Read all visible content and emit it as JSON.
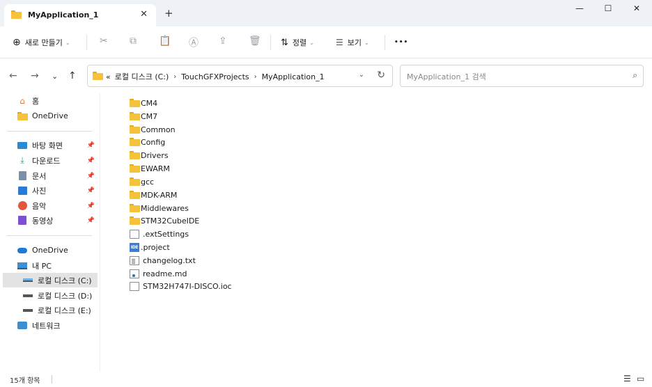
{
  "tab": {
    "title": "MyApplication_1",
    "close": "✕",
    "new_tab": "+"
  },
  "window": {
    "minimize": "—",
    "maximize": "☐",
    "close": "✕"
  },
  "toolbar": {
    "new_label": "새로 만들기",
    "new_plus": "⊕",
    "chevron": "⌄",
    "sort_label": "정렬",
    "sort_icon": "⇅",
    "view_label": "보기",
    "view_icon": "☰",
    "more": "•••",
    "icons": {
      "cut": "✂",
      "copy": "⧉",
      "paste": "📋",
      "rename": "Ⓐ",
      "share": "⇪",
      "delete": "🗑"
    }
  },
  "nav": {
    "back": "←",
    "forward": "→",
    "recent": "⌄",
    "up": "↑",
    "overflow": "«",
    "crumbs": [
      "로컬 디스크 (C:)",
      "TouchGFXProjects",
      "MyApplication_1"
    ],
    "crumb_sep": "›",
    "dropdown": "⌄",
    "refresh": "↻"
  },
  "search": {
    "placeholder": "MyApplication_1 검색",
    "icon": "⌕"
  },
  "sidebar": {
    "home": "홈",
    "onedrive_top": "OneDrive",
    "pinned": [
      "바탕 화면",
      "다운로드",
      "문서",
      "사진",
      "음악",
      "동영상"
    ],
    "pin_icon": "📌",
    "onedrive": "OneDrive",
    "this_pc": "내 PC",
    "drives": [
      "로컬 디스크 (C:)",
      "로컬 디스크 (D:)",
      "로컬 디스크 (E:)"
    ],
    "network": "네트워크"
  },
  "files": [
    {
      "name": "CM4",
      "kind": "folder"
    },
    {
      "name": "CM7",
      "kind": "folder"
    },
    {
      "name": "Common",
      "kind": "folder"
    },
    {
      "name": "Config",
      "kind": "folder"
    },
    {
      "name": "Drivers",
      "kind": "folder"
    },
    {
      "name": "EWARM",
      "kind": "folder"
    },
    {
      "name": "gcc",
      "kind": "folder"
    },
    {
      "name": "MDK-ARM",
      "kind": "folder"
    },
    {
      "name": "Middlewares",
      "kind": "folder"
    },
    {
      "name": "STM32CubeIDE",
      "kind": "folder"
    },
    {
      "name": ".extSettings",
      "kind": "file"
    },
    {
      "name": ".project",
      "kind": "ide",
      "badge": "IDE"
    },
    {
      "name": "changelog.txt",
      "kind": "txt"
    },
    {
      "name": "readme.md",
      "kind": "md"
    },
    {
      "name": "STM32H747I-DISCO.ioc",
      "kind": "file"
    }
  ],
  "status": {
    "count": "15개 항목",
    "details_view": "☰",
    "tiles_view": "▭"
  },
  "colors": {
    "folder": "#f5c33b",
    "selected": "#e3e3e3",
    "titlebar": "#eef1f6"
  }
}
